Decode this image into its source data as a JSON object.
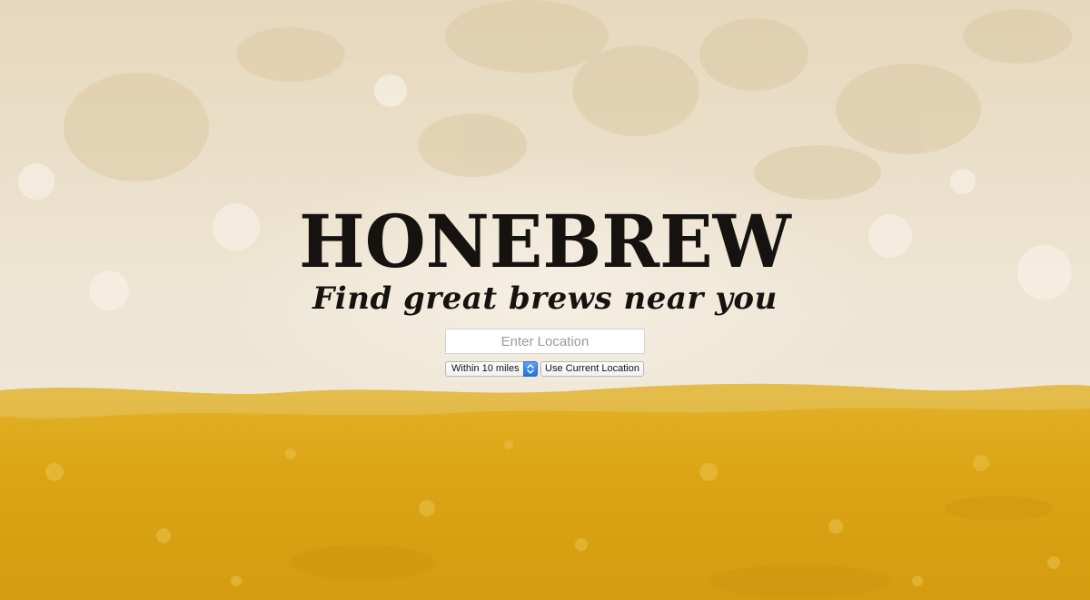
{
  "colors": {
    "foam": "#e8dcc4",
    "foam_light": "#f3ece0",
    "beer": "#dba516",
    "beer_dark": "#c98f0a",
    "text": "#151210",
    "select_accent": "#1f6fe0"
  },
  "hero": {
    "title": "HONEBREW",
    "tagline": "Find great brews near you"
  },
  "search": {
    "location_placeholder": "Enter Location",
    "location_value": "",
    "radius_selected": "Within 10 miles",
    "use_current_location_label": "Use Current Location"
  },
  "icons": {
    "select_arrows": "up-down-chevron-icon"
  }
}
